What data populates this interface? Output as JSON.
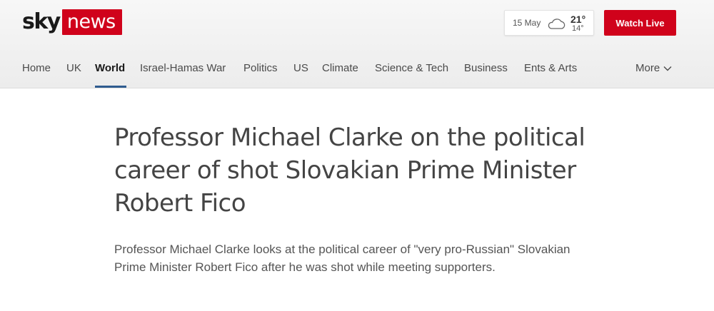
{
  "brand": {
    "sky": "sky",
    "news": "news",
    "red": "#d0021b"
  },
  "weather": {
    "date": "15 May",
    "icon": "cloud-icon",
    "high": "21°",
    "low": "14°"
  },
  "watch_live": {
    "label": "Watch Live"
  },
  "nav": {
    "items": [
      {
        "label": "Home"
      },
      {
        "label": "UK"
      },
      {
        "label": "World",
        "active": true
      },
      {
        "label": "Israel-Hamas War"
      },
      {
        "label": "Politics"
      },
      {
        "label": "US"
      },
      {
        "label": "Climate"
      },
      {
        "label": "Science & Tech"
      },
      {
        "label": "Business"
      },
      {
        "label": "Ents & Arts"
      }
    ],
    "more_label": "More",
    "active_color": "#2f5c8f"
  },
  "article": {
    "headline": "Professor Michael Clarke on the political career of shot Slovakian Prime Minister Robert Fico",
    "standfirst": "Professor Michael Clarke looks at the political career of \"very pro-Russian\" Slovakian Prime Minister Robert Fico after he was shot while meeting supporters."
  }
}
